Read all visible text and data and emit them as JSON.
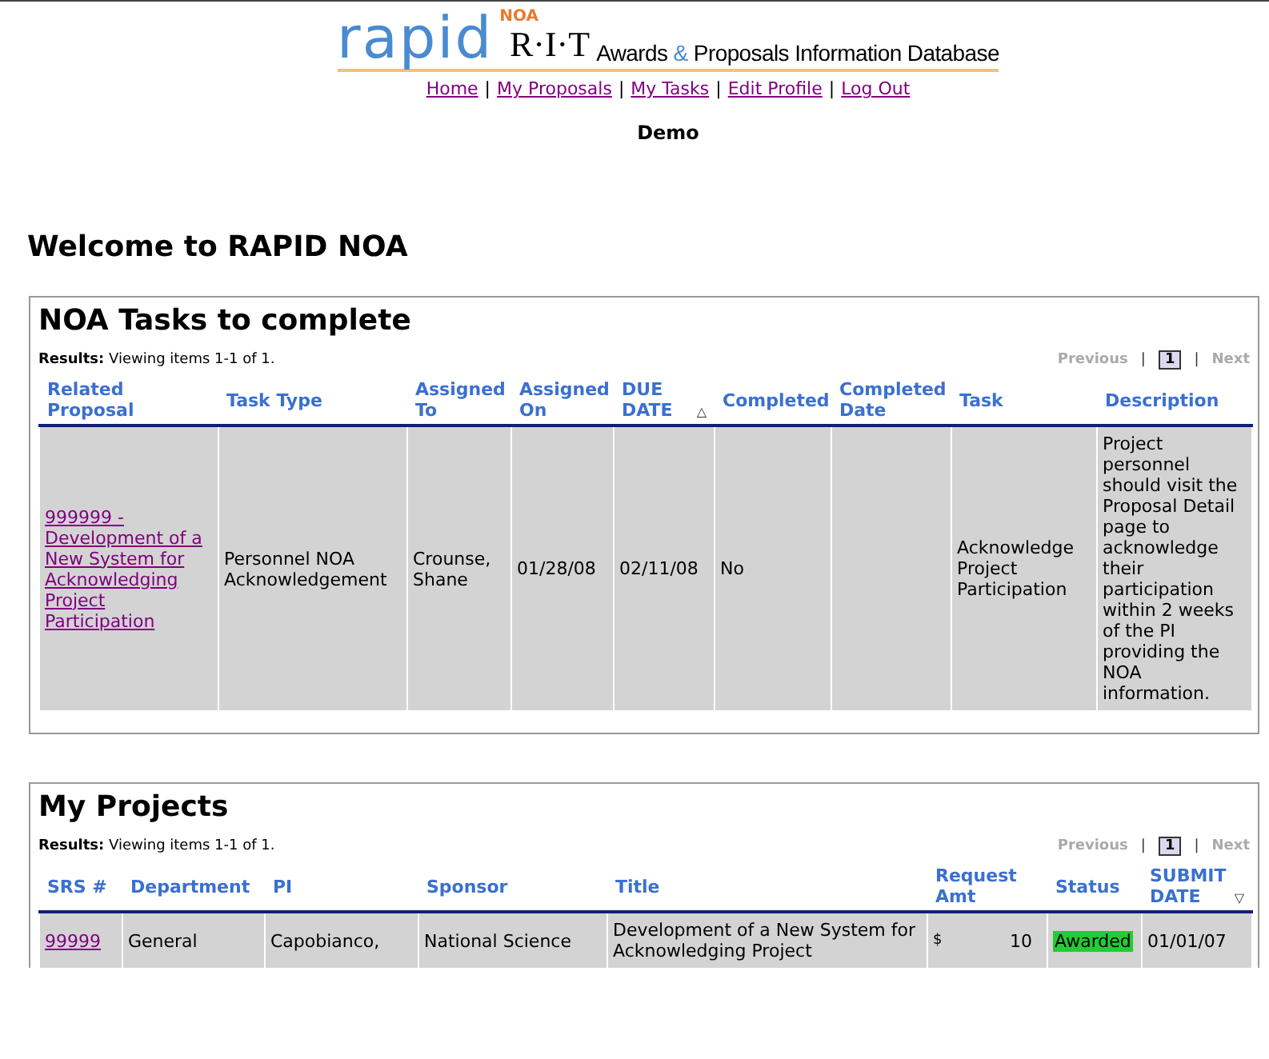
{
  "header": {
    "logo": {
      "rapid": "rapid",
      "noa": "NOA",
      "rit": "R·I·T",
      "tagline_start": "Awards ",
      "amp": "&",
      "tagline_end": " Proposals Information Database"
    },
    "nav": [
      "Home",
      "My Proposals",
      "My Tasks",
      "Edit Profile",
      "Log Out"
    ],
    "nav_separator": "|",
    "user": "Demo"
  },
  "welcome": "Welcome to RAPID NOA",
  "panels": [
    {
      "title": "NOA Tasks to complete",
      "results": "**Results:** Viewing items 1-1 of 1.",
      "pager": {
        "previous": "Previous",
        "separator": "|",
        "pages": [
          {
            "label": "1",
            "selected": true
          }
        ],
        "next": "Next"
      },
      "columns": [
        {
          "label": "Related Proposal"
        },
        {
          "label": "Task Type"
        },
        {
          "label": "Assigned To"
        },
        {
          "label": "Assigned On"
        },
        {
          "label": "DUE DATE",
          "sort_mark": "△"
        },
        {
          "label": "Completed"
        },
        {
          "label": "Completed Date"
        },
        {
          "label": "Task"
        },
        {
          "label": "Description"
        }
      ],
      "rows": [
        {
          "cells": [
            {
              "kind": "link",
              "text": "999999 - Development of a New System for Acknowledging Project Participation"
            },
            {
              "kind": "text",
              "text": "Personnel NOA Acknowledgement"
            },
            {
              "kind": "text",
              "text": "Crounse, Shane"
            },
            {
              "kind": "text",
              "text": "01/28/08"
            },
            {
              "kind": "text",
              "text": "02/11/08"
            },
            {
              "kind": "text",
              "text": "No"
            },
            {
              "kind": "empty"
            },
            {
              "kind": "text",
              "text": "Acknowledge Project Participation"
            },
            {
              "kind": "text",
              "text": "Project personnel should visit the Proposal Detail page to acknowledge their participation within 2 weeks of the PI providing the NOA information."
            }
          ]
        }
      ]
    },
    {
      "title": "My Projects",
      "results": "**Results:** Viewing items 1-1 of 1.",
      "pager": {
        "previous": "Previous",
        "separator": "|",
        "pages": [
          {
            "label": "1",
            "selected": true
          }
        ],
        "next": "Next"
      },
      "columns": [
        {
          "label": "SRS #"
        },
        {
          "label": "Department"
        },
        {
          "label": "PI"
        },
        {
          "label": "Sponsor"
        },
        {
          "label": "Title"
        },
        {
          "label": "Request Amt"
        },
        {
          "label": "Status"
        },
        {
          "label": "SUBMIT DATE",
          "sort_mark": "▽"
        }
      ],
      "rows": [
        {
          "cells": [
            {
              "kind": "link",
              "text": "99999"
            },
            {
              "kind": "text",
              "text": "General"
            },
            {
              "kind": "text",
              "text": "Capobianco,"
            },
            {
              "kind": "text",
              "text": "National Science"
            },
            {
              "kind": "text",
              "text": "Development of a New System for Acknowledging Project"
            },
            {
              "kind": "money",
              "currency": "$",
              "text": "10"
            },
            {
              "kind": "status",
              "text": "Awarded",
              "color": "#22cc33"
            },
            {
              "kind": "text",
              "text": "01/01/07"
            }
          ]
        }
      ]
    }
  ]
}
